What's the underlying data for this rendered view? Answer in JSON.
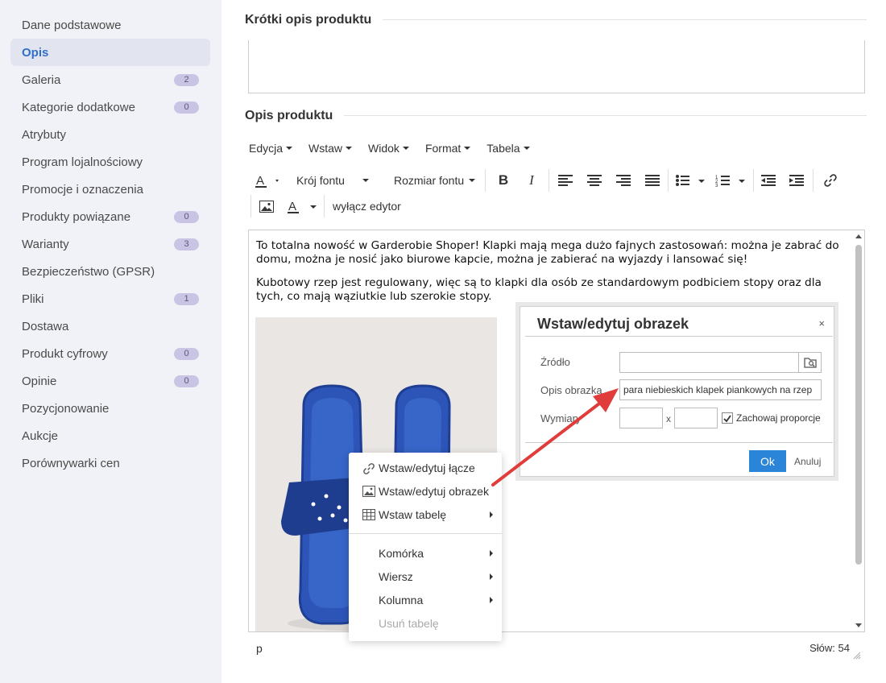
{
  "sidebar": {
    "items": [
      {
        "label": "Dane podstawowe",
        "badge": null
      },
      {
        "label": "Opis",
        "badge": null,
        "active": true
      },
      {
        "label": "Galeria",
        "badge": "2"
      },
      {
        "label": "Kategorie dodatkowe",
        "badge": "0"
      },
      {
        "label": "Atrybuty",
        "badge": null
      },
      {
        "label": "Program lojalnościowy",
        "badge": null
      },
      {
        "label": "Promocje i oznaczenia",
        "badge": null
      },
      {
        "label": "Produkty powiązane",
        "badge": "0"
      },
      {
        "label": "Warianty",
        "badge": "3"
      },
      {
        "label": "Bezpieczeństwo (GPSR)",
        "badge": null
      },
      {
        "label": "Pliki",
        "badge": "1"
      },
      {
        "label": "Dostawa",
        "badge": null
      },
      {
        "label": "Produkt cyfrowy",
        "badge": "0"
      },
      {
        "label": "Opinie",
        "badge": "0"
      },
      {
        "label": "Pozycjonowanie",
        "badge": null
      },
      {
        "label": "Aukcje",
        "badge": null
      },
      {
        "label": "Porównywarki cen",
        "badge": null
      }
    ]
  },
  "sections": {
    "short_title": "Krótki opis produktu",
    "long_title": "Opis produktu"
  },
  "menubar": [
    "Edycja",
    "Wstaw",
    "Widok",
    "Format",
    "Tabela"
  ],
  "toolbar": {
    "font_family": "Krój fontu",
    "font_size": "Rozmiar fontu",
    "disable_editor": "wyłącz edytor"
  },
  "editor": {
    "paragraph1": "To totalna nowość w  Garderobie Shoper! Klapki mają mega dużo fajnych zastosowań: można je zabrać do domu, można je nosić jako biurowe kapcie, można je zabierać na wyjazdy i lansować się!",
    "paragraph2": "Kubotowy rzep jest regulowany, więc są to klapki dla osób ze standardowym podbiciem stopy oraz dla tych, co mają wąziutkie lub szerokie stopy."
  },
  "statusbar": {
    "element": "p",
    "word_count": "Słów: 54"
  },
  "context_menu": {
    "items": [
      "Wstaw/edytuj łącze",
      "Wstaw/edytuj obrazek",
      "Wstaw tabelę",
      "Komórka",
      "Wiersz",
      "Kolumna",
      "Usuń tabelę"
    ]
  },
  "dialog": {
    "title": "Wstaw/edytuj obrazek",
    "close": "×",
    "source_label": "Źródło",
    "source_value": "",
    "alt_label": "Opis obrazka",
    "alt_value": "para niebieskich klapek piankowych na rzep",
    "dims_label": "Wymiary",
    "width_value": "",
    "height_value": "",
    "x_label": "x",
    "keep_ratio_label": "Zachowaj proporcje",
    "ok_label": "Ok",
    "cancel_label": "Anuluj"
  },
  "colors": {
    "accent": "#2f6fc8",
    "ok_button": "#2a85d8",
    "arrow": "#e03c3c",
    "badge_bg": "#c9c4e3",
    "sandal": "#2d55b8"
  }
}
